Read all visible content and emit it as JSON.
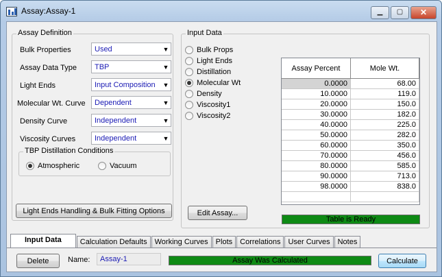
{
  "window": {
    "title": "Assay:Assay-1"
  },
  "definition": {
    "legend": "Assay Definition",
    "rows": [
      {
        "label": "Bulk Properties",
        "value": "Used"
      },
      {
        "label": "Assay Data Type",
        "value": "TBP"
      },
      {
        "label": "Light Ends",
        "value": "Input Composition"
      },
      {
        "label": "Molecular Wt. Curve",
        "value": "Dependent"
      },
      {
        "label": "Density Curve",
        "value": "Independent"
      },
      {
        "label": "Viscosity Curves",
        "value": "Independent"
      }
    ],
    "tbp": {
      "legend": "TBP Distillation Conditions",
      "atmospheric": "Atmospheric",
      "vacuum": "Vacuum",
      "selected": "Atmospheric"
    },
    "light_ends_button": "Light Ends Handling & Bulk Fitting Options"
  },
  "input": {
    "legend": "Input Data",
    "options": [
      "Bulk Props",
      "Light Ends",
      "Distillation",
      "Molecular Wt",
      "Density",
      "Viscosity1",
      "Viscosity2"
    ],
    "selected": "Molecular Wt",
    "edit_button": "Edit Assay...",
    "table": {
      "headers": [
        "Assay Percent",
        "Mole Wt."
      ],
      "rows": [
        [
          "0.0000",
          "68.00"
        ],
        [
          "10.0000",
          "119.0"
        ],
        [
          "20.0000",
          "150.0"
        ],
        [
          "30.0000",
          "182.0"
        ],
        [
          "40.0000",
          "225.0"
        ],
        [
          "50.0000",
          "282.0"
        ],
        [
          "60.0000",
          "350.0"
        ],
        [
          "70.0000",
          "456.0"
        ],
        [
          "80.0000",
          "585.0"
        ],
        [
          "90.0000",
          "713.0"
        ],
        [
          "98.0000",
          "838.0"
        ]
      ]
    },
    "table_status": "Table is Ready"
  },
  "tabs": [
    "Input Data",
    "Calculation Defaults",
    "Working Curves",
    "Plots",
    "Correlations",
    "User Curves",
    "Notes"
  ],
  "active_tab": "Input Data",
  "footer": {
    "delete": "Delete",
    "name_label": "Name:",
    "name_value": "Assay-1",
    "status": "Assay Was Calculated",
    "calculate": "Calculate"
  },
  "colors": {
    "status_green": "#0e8a14",
    "value_blue": "#1a1ab4"
  }
}
